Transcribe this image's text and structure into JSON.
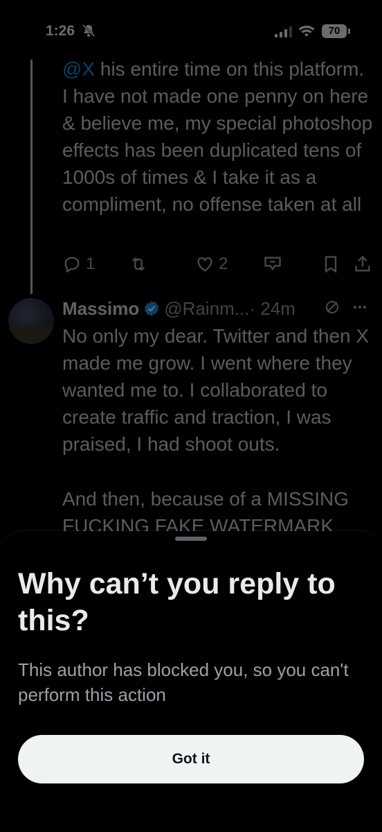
{
  "status_bar": {
    "time": "1:26",
    "battery": "70",
    "icons": [
      "bell-slash-icon",
      "signal-icon",
      "wifi-icon",
      "battery-icon"
    ]
  },
  "tweet_1": {
    "mention": "@X",
    "text": " his entire time on this platform. I have not made one penny on here & believe me, my special photoshop effects has been duplicated tens of 1000s of times & I take it as a compliment, no offense taken at all",
    "reply_count": "1",
    "like_count": "2"
  },
  "tweet_2": {
    "name": "Massimo",
    "handle": "@Rainm...",
    "time": "· 24m",
    "text": "No only my dear. Twitter and then X made me grow. I went where they wanted me to. I collaborated to create traffic and traction, I was praised, I had shoot outs.",
    "text_2": "And then, because of a MISSING FUCKING FAKE WATERMARK"
  },
  "sheet": {
    "title": "Why can’t you reply to this?",
    "body": "This author has blocked you, so you can't perform this action",
    "button_label": "Got it"
  },
  "colors": {
    "background": "#000000",
    "mention": "#1d9bf0",
    "verified": "#1d9bf0",
    "button_bg": "#eff3f4"
  }
}
